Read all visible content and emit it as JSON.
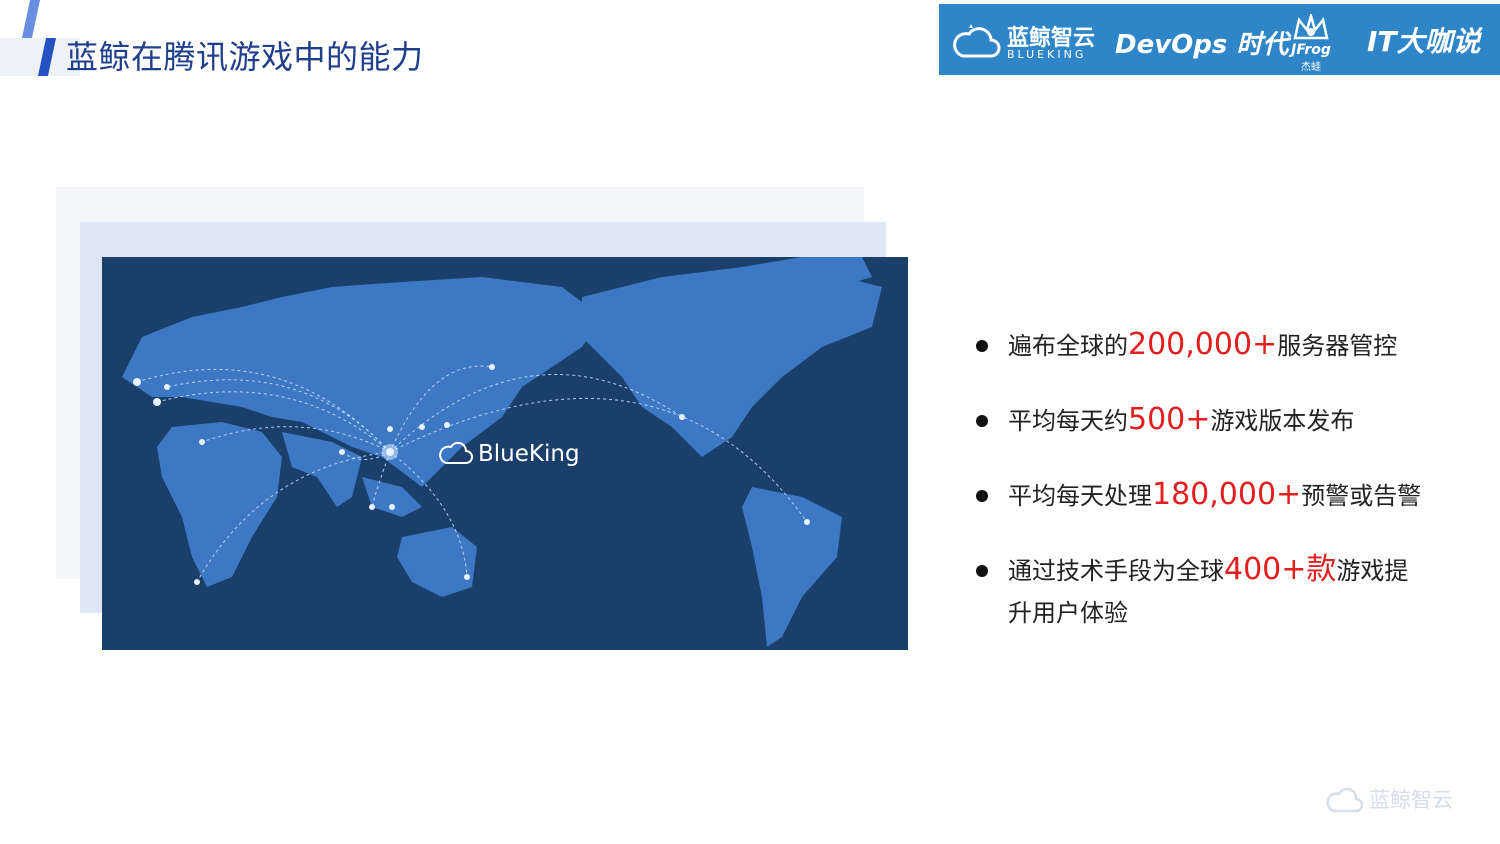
{
  "header": {
    "title": "蓝鲸在腾讯游戏中的能力",
    "logos": {
      "blueking_cn": "蓝鲸智云",
      "blueking_en": "BLUEKING",
      "devops": "DevOps 时代",
      "jfrog_word": "JFrog",
      "jfrog_cn": "杰蛙",
      "it": "IT大咖说"
    }
  },
  "map": {
    "label": "BlueKing"
  },
  "bullets": [
    {
      "pre": "遍布全球的",
      "highlight": "200,000+",
      "post": "服务器管控"
    },
    {
      "pre": "平均每天约",
      "highlight": "500+",
      "post": "游戏版本发布"
    },
    {
      "pre": "平均每天处理",
      "highlight": "180,000+",
      "post": "预警或告警"
    },
    {
      "pre": "通过技术手段为全球",
      "highlight": "400+款",
      "post": "游戏提升用户体验"
    }
  ],
  "footer": {
    "brand": "蓝鲸智云"
  },
  "colors": {
    "accent": "#1f3f8c",
    "highlight": "#e21e1e",
    "logo_strip": "#2e86c8",
    "map_bg": "#1b3f6b",
    "land": "#3d78c4"
  }
}
